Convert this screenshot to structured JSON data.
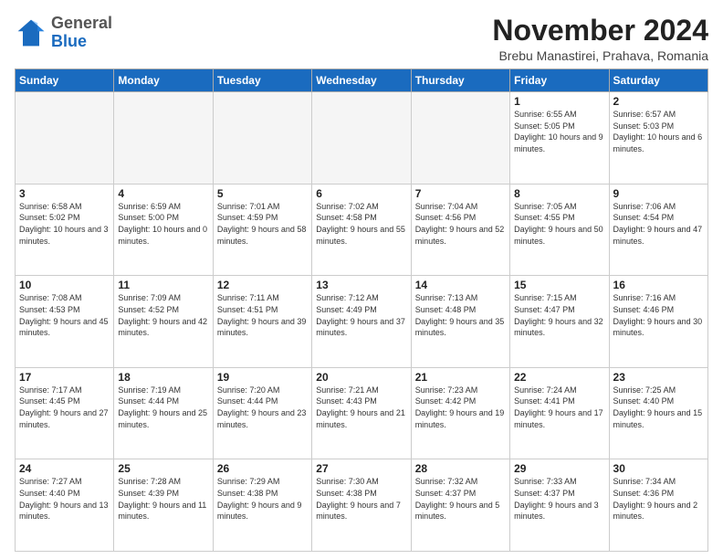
{
  "logo": {
    "general": "General",
    "blue": "Blue"
  },
  "header": {
    "title": "November 2024",
    "location": "Brebu Manastirei, Prahava, Romania"
  },
  "days_of_week": [
    "Sunday",
    "Monday",
    "Tuesday",
    "Wednesday",
    "Thursday",
    "Friday",
    "Saturday"
  ],
  "weeks": [
    [
      {
        "day": "",
        "info": ""
      },
      {
        "day": "",
        "info": ""
      },
      {
        "day": "",
        "info": ""
      },
      {
        "day": "",
        "info": ""
      },
      {
        "day": "",
        "info": ""
      },
      {
        "day": "1",
        "info": "Sunrise: 6:55 AM\nSunset: 5:05 PM\nDaylight: 10 hours and 9 minutes."
      },
      {
        "day": "2",
        "info": "Sunrise: 6:57 AM\nSunset: 5:03 PM\nDaylight: 10 hours and 6 minutes."
      }
    ],
    [
      {
        "day": "3",
        "info": "Sunrise: 6:58 AM\nSunset: 5:02 PM\nDaylight: 10 hours and 3 minutes."
      },
      {
        "day": "4",
        "info": "Sunrise: 6:59 AM\nSunset: 5:00 PM\nDaylight: 10 hours and 0 minutes."
      },
      {
        "day": "5",
        "info": "Sunrise: 7:01 AM\nSunset: 4:59 PM\nDaylight: 9 hours and 58 minutes."
      },
      {
        "day": "6",
        "info": "Sunrise: 7:02 AM\nSunset: 4:58 PM\nDaylight: 9 hours and 55 minutes."
      },
      {
        "day": "7",
        "info": "Sunrise: 7:04 AM\nSunset: 4:56 PM\nDaylight: 9 hours and 52 minutes."
      },
      {
        "day": "8",
        "info": "Sunrise: 7:05 AM\nSunset: 4:55 PM\nDaylight: 9 hours and 50 minutes."
      },
      {
        "day": "9",
        "info": "Sunrise: 7:06 AM\nSunset: 4:54 PM\nDaylight: 9 hours and 47 minutes."
      }
    ],
    [
      {
        "day": "10",
        "info": "Sunrise: 7:08 AM\nSunset: 4:53 PM\nDaylight: 9 hours and 45 minutes."
      },
      {
        "day": "11",
        "info": "Sunrise: 7:09 AM\nSunset: 4:52 PM\nDaylight: 9 hours and 42 minutes."
      },
      {
        "day": "12",
        "info": "Sunrise: 7:11 AM\nSunset: 4:51 PM\nDaylight: 9 hours and 39 minutes."
      },
      {
        "day": "13",
        "info": "Sunrise: 7:12 AM\nSunset: 4:49 PM\nDaylight: 9 hours and 37 minutes."
      },
      {
        "day": "14",
        "info": "Sunrise: 7:13 AM\nSunset: 4:48 PM\nDaylight: 9 hours and 35 minutes."
      },
      {
        "day": "15",
        "info": "Sunrise: 7:15 AM\nSunset: 4:47 PM\nDaylight: 9 hours and 32 minutes."
      },
      {
        "day": "16",
        "info": "Sunrise: 7:16 AM\nSunset: 4:46 PM\nDaylight: 9 hours and 30 minutes."
      }
    ],
    [
      {
        "day": "17",
        "info": "Sunrise: 7:17 AM\nSunset: 4:45 PM\nDaylight: 9 hours and 27 minutes."
      },
      {
        "day": "18",
        "info": "Sunrise: 7:19 AM\nSunset: 4:44 PM\nDaylight: 9 hours and 25 minutes."
      },
      {
        "day": "19",
        "info": "Sunrise: 7:20 AM\nSunset: 4:44 PM\nDaylight: 9 hours and 23 minutes."
      },
      {
        "day": "20",
        "info": "Sunrise: 7:21 AM\nSunset: 4:43 PM\nDaylight: 9 hours and 21 minutes."
      },
      {
        "day": "21",
        "info": "Sunrise: 7:23 AM\nSunset: 4:42 PM\nDaylight: 9 hours and 19 minutes."
      },
      {
        "day": "22",
        "info": "Sunrise: 7:24 AM\nSunset: 4:41 PM\nDaylight: 9 hours and 17 minutes."
      },
      {
        "day": "23",
        "info": "Sunrise: 7:25 AM\nSunset: 4:40 PM\nDaylight: 9 hours and 15 minutes."
      }
    ],
    [
      {
        "day": "24",
        "info": "Sunrise: 7:27 AM\nSunset: 4:40 PM\nDaylight: 9 hours and 13 minutes."
      },
      {
        "day": "25",
        "info": "Sunrise: 7:28 AM\nSunset: 4:39 PM\nDaylight: 9 hours and 11 minutes."
      },
      {
        "day": "26",
        "info": "Sunrise: 7:29 AM\nSunset: 4:38 PM\nDaylight: 9 hours and 9 minutes."
      },
      {
        "day": "27",
        "info": "Sunrise: 7:30 AM\nSunset: 4:38 PM\nDaylight: 9 hours and 7 minutes."
      },
      {
        "day": "28",
        "info": "Sunrise: 7:32 AM\nSunset: 4:37 PM\nDaylight: 9 hours and 5 minutes."
      },
      {
        "day": "29",
        "info": "Sunrise: 7:33 AM\nSunset: 4:37 PM\nDaylight: 9 hours and 3 minutes."
      },
      {
        "day": "30",
        "info": "Sunrise: 7:34 AM\nSunset: 4:36 PM\nDaylight: 9 hours and 2 minutes."
      }
    ]
  ]
}
